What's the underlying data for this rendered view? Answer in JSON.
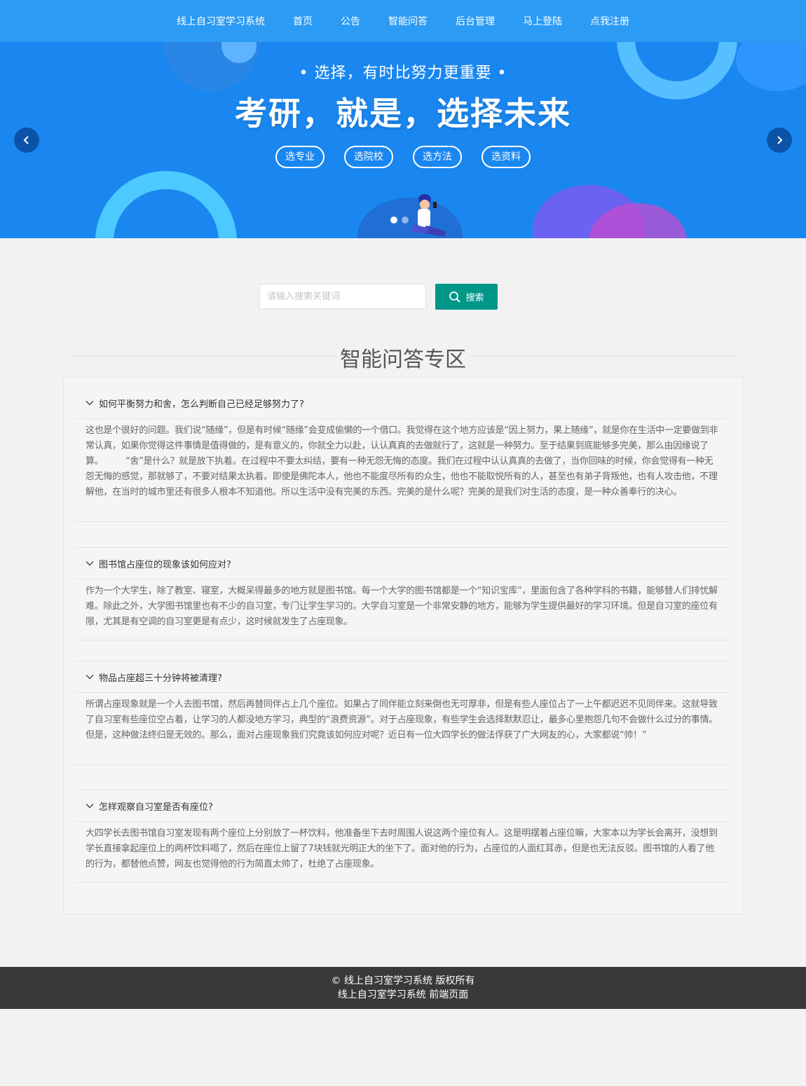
{
  "nav": {
    "items": [
      "线上自习室学习系统",
      "首页",
      "公告",
      "智能问答",
      "后台管理",
      "马上登陆",
      "点我注册"
    ]
  },
  "banner": {
    "subtitle": "• 选择，有时比努力更重要 •",
    "headline": "考研，就是，选择未来",
    "pills": [
      "选专业",
      "选院校",
      "选方法",
      "选资料"
    ]
  },
  "search": {
    "placeholder": "请输入搜索关键词",
    "button_label": "搜索"
  },
  "section": {
    "title": "智能问答专区"
  },
  "faq": [
    {
      "question": "如何平衡努力和舍，怎么判断自己已经足够努力了?",
      "answer": "这也是个很好的问题。我们说“随缘”，但是有时候“随缘”会变成偷懒的一个借口。我觉得在这个地方应该是“因上努力，果上随缘”，就是你在生活中一定要做到非常认真，如果你觉得这件事情是值得做的，是有意义的，你就全力以赴，认认真真的去做就行了，这就是一种努力。至于结果到底能够多完美，那么由因缘说了算。　　　“舍”是什么？就是放下执着。在过程中不要太纠结，要有一种无怨无悔的态度。我们在过程中认认真真的去做了，当你回味的时候，你会觉得有一种无怨无悔的感觉，那就够了，不要对结果太执着。即使是佛陀本人，他也不能度尽所有的众生，他也不能取悦所有的人，甚至也有弟子背叛他，也有人攻击他，不理解他，在当时的城市里还有很多人根本不知道他。所以生活中没有完美的东西。完美的是什么呢？完美的是我们对生活的态度，是一种众善奉行的决心。"
    },
    {
      "question": "图书馆占座位的现象该如何应对?",
      "answer": "作为一个大学生，除了教室、寝室，大概呆得最多的地方就是图书馆。每一个大学的图书馆都是一个“知识宝库”，里面包含了各种学科的书籍，能够替人们排忧解难。除此之外，大学图书馆里也有不少的自习室，专门让学生学习的。大学自习室是一个非常安静的地方，能够为学生提供最好的学习环境。但是自习室的座位有限，尤其是有空调的自习室更是有点少，这时候就发生了占座现象。"
    },
    {
      "question": "物品占座超三十分钟将被清理?",
      "answer": "所谓占座现象就是一个人去图书馆，然后再替同伴占上几个座位。如果占了同伴能立刻来倒也无可厚非，但是有些人座位占了一上午都迟迟不见同伴来。这就导致了自习室有些座位空占着，让学习的人都没地方学习，典型的“浪费资源”。对于占座现象，有些学生会选择默默忍让，最多心里抱怨几句不会做什么过分的事情。但是，这种做法终归是无效的。那么，面对占座现象我们究竟该如何应对呢？近日有一位大四学长的做法俘获了广大网友的心，大家都说“帅！”"
    },
    {
      "question": "怎样观察自习室是否有座位?",
      "answer": "大四学长去图书馆自习室发现有两个座位上分别放了一杯饮料，他准备坐下去时周围人说这两个座位有人。这是明摆着占座位嘛，大家本以为学长会离开，没想到学长直接拿起座位上的两杯饮料喝了，然后在座位上留了7块钱就光明正大的坐下了。面对他的行为，占座位的人面红耳赤，但是也无法反驳。图书馆的人看了他的行为，都替他点赞，网友也觉得他的行为简直太帅了，杜绝了占座现象。"
    }
  ],
  "footer": {
    "line1": "© 线上自习室学习系统 版权所有",
    "line2": "线上自习室学习系统 前端页面"
  },
  "colors": {
    "nav": "#2b9bf4",
    "banner": "#1a87f0",
    "search_button": "#009688",
    "footer": "#393939"
  }
}
